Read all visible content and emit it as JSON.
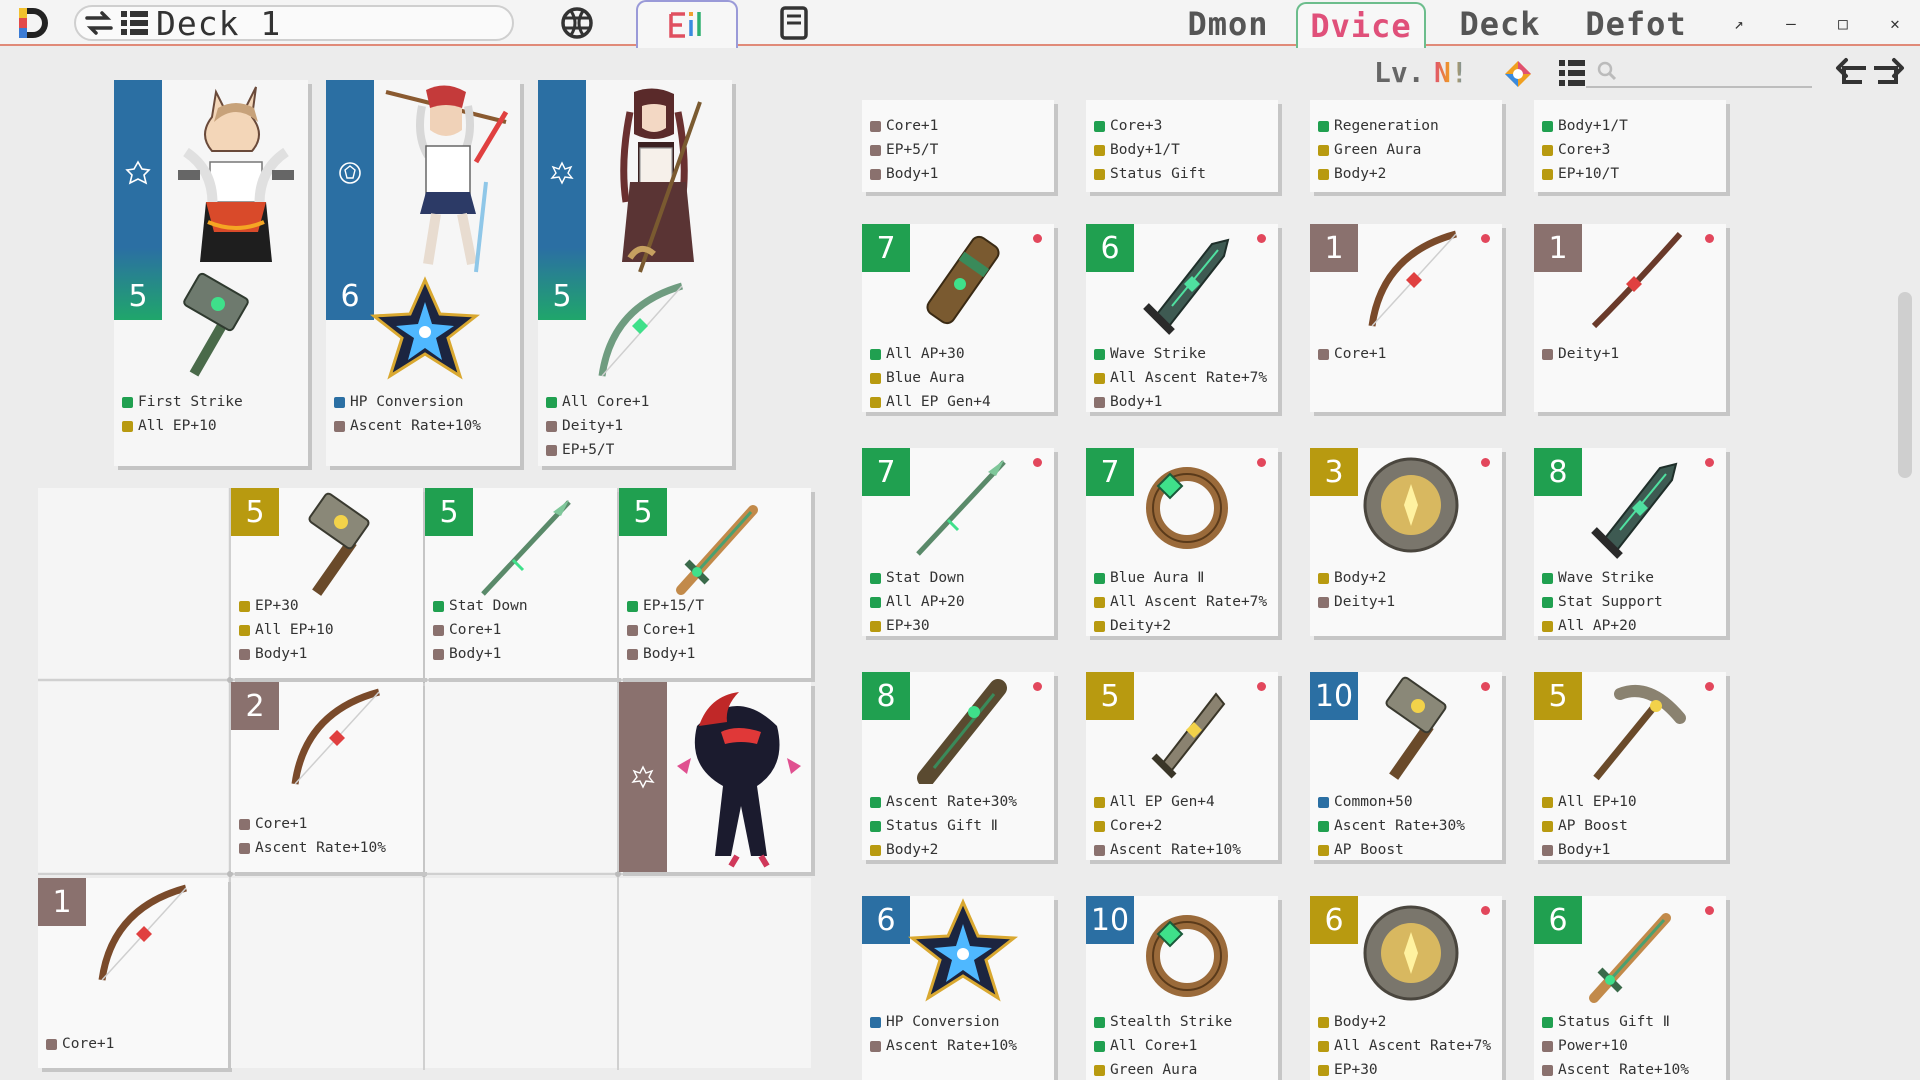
{
  "colors": {
    "green": "#20a050",
    "gold": "#b89a10",
    "brown": "#8a716e",
    "blue": "#2b6fa3",
    "dot_red": "#e2475c",
    "tab_pink": "#e0507a"
  },
  "header": {
    "deck_title": "Deck 1",
    "tabs": [
      {
        "label": "Dmon"
      },
      {
        "label": "Dvice"
      },
      {
        "label": "Deck"
      },
      {
        "label": "Defot"
      }
    ],
    "window_controls": {
      "restore": "↗",
      "minimize": "–",
      "maximize": "□",
      "close": "✕"
    }
  },
  "toolbar": {
    "lv_label": "Lv.",
    "n_label": "N!",
    "search_placeholder": ""
  },
  "characters": [
    {
      "level": "5",
      "effects": [
        {
          "text": "First Strike",
          "color": "green"
        },
        {
          "text": "All EP+10",
          "color": "gold"
        }
      ]
    },
    {
      "level": "6",
      "effects": [
        {
          "text": "HP Conversion",
          "color": "blue"
        },
        {
          "text": "Ascent Rate+10%",
          "color": "brown"
        }
      ]
    },
    {
      "level": "5",
      "effects": [
        {
          "text": "All Core+1",
          "color": "green"
        },
        {
          "text": "Deity+1",
          "color": "brown"
        },
        {
          "text": "EP+5/T",
          "color": "brown"
        }
      ]
    }
  ],
  "grid": {
    "cells": [
      {
        "id": "c1",
        "level": "5",
        "badge": "gold",
        "icon": "hammer-icon",
        "effects": [
          {
            "text": "EP+30",
            "color": "gold"
          },
          {
            "text": "All EP+10",
            "color": "gold"
          },
          {
            "text": "Body+1",
            "color": "brown"
          }
        ]
      },
      {
        "id": "c2",
        "level": "5",
        "badge": "green",
        "icon": "spear-icon",
        "effects": [
          {
            "text": "Stat Down",
            "color": "green"
          },
          {
            "text": "Core+1",
            "color": "brown"
          },
          {
            "text": "Body+1",
            "color": "brown"
          }
        ]
      },
      {
        "id": "c3",
        "level": "5",
        "badge": "green",
        "icon": "sword-icon",
        "effects": [
          {
            "text": "EP+15/T",
            "color": "green"
          },
          {
            "text": "Core+1",
            "color": "brown"
          },
          {
            "text": "Body+1",
            "color": "brown"
          }
        ]
      },
      {
        "id": "c4",
        "level": "2",
        "badge": "brown",
        "icon": "bow-icon",
        "effects": [
          {
            "text": "Core+1",
            "color": "brown"
          },
          {
            "text": "Ascent Rate+10%",
            "color": "brown"
          }
        ]
      },
      {
        "id": "c5",
        "level": "1",
        "badge": "brown",
        "icon": "bow-icon",
        "effects": [
          {
            "text": "Core+1",
            "color": "brown"
          }
        ]
      }
    ]
  },
  "inventory": {
    "top_partial": [
      [
        {
          "text": "Core+1",
          "color": "brown"
        },
        {
          "text": "EP+5/T",
          "color": "brown"
        },
        {
          "text": "Body+1",
          "color": "brown"
        }
      ],
      [
        {
          "text": "Core+3",
          "color": "green"
        },
        {
          "text": "Body+1/T",
          "color": "gold"
        },
        {
          "text": "Status Gift",
          "color": "gold"
        }
      ],
      [
        {
          "text": "Regeneration",
          "color": "green"
        },
        {
          "text": "Green Aura",
          "color": "gold"
        },
        {
          "text": "Body+2",
          "color": "gold"
        }
      ],
      [
        {
          "text": "Body+1/T",
          "color": "green"
        },
        {
          "text": "Core+3",
          "color": "gold"
        },
        {
          "text": "EP+10/T",
          "color": "gold"
        }
      ]
    ],
    "items": [
      {
        "level": "7",
        "badge": "green",
        "icon": "cannon-icon",
        "effects": [
          {
            "text": "All AP+30",
            "color": "green"
          },
          {
            "text": "Blue Aura",
            "color": "gold"
          },
          {
            "text": "All EP Gen+4",
            "color": "gold"
          }
        ]
      },
      {
        "level": "6",
        "badge": "green",
        "icon": "greatsword-icon",
        "effects": [
          {
            "text": "Wave Strike",
            "color": "green"
          },
          {
            "text": "All Ascent Rate+7%",
            "color": "gold"
          },
          {
            "text": "Body+1",
            "color": "brown"
          }
        ]
      },
      {
        "level": "1",
        "badge": "brown",
        "icon": "bow-icon",
        "effects": [
          {
            "text": "Core+1",
            "color": "brown"
          }
        ]
      },
      {
        "level": "1",
        "badge": "brown",
        "icon": "staff-icon",
        "effects": [
          {
            "text": "Deity+1",
            "color": "brown"
          }
        ]
      },
      {
        "level": "7",
        "badge": "green",
        "icon": "spear-icon",
        "effects": [
          {
            "text": "Stat Down",
            "color": "green"
          },
          {
            "text": "All AP+20",
            "color": "green"
          },
          {
            "text": "EP+30",
            "color": "gold"
          }
        ]
      },
      {
        "level": "7",
        "badge": "green",
        "icon": "ring-icon",
        "effects": [
          {
            "text": "Blue Aura Ⅱ",
            "color": "green"
          },
          {
            "text": "All Ascent Rate+7%",
            "color": "gold"
          },
          {
            "text": "Deity+2",
            "color": "gold"
          }
        ]
      },
      {
        "level": "3",
        "badge": "gold",
        "icon": "medallion-icon",
        "effects": [
          {
            "text": "Body+2",
            "color": "gold"
          },
          {
            "text": "Deity+1",
            "color": "brown"
          }
        ]
      },
      {
        "level": "8",
        "badge": "green",
        "icon": "greatsword-icon",
        "effects": [
          {
            "text": "Wave Strike",
            "color": "green"
          },
          {
            "text": "Stat Support",
            "color": "green"
          },
          {
            "text": "All AP+20",
            "color": "gold"
          }
        ]
      },
      {
        "level": "8",
        "badge": "green",
        "icon": "club-icon",
        "effects": [
          {
            "text": "Ascent Rate+30%",
            "color": "green"
          },
          {
            "text": "Status Gift Ⅱ",
            "color": "green"
          },
          {
            "text": "Body+2",
            "color": "gold"
          }
        ]
      },
      {
        "level": "5",
        "badge": "gold",
        "icon": "dagger-icon",
        "effects": [
          {
            "text": "All EP Gen+4",
            "color": "gold"
          },
          {
            "text": "Core+2",
            "color": "gold"
          },
          {
            "text": "Ascent Rate+10%",
            "color": "brown"
          }
        ]
      },
      {
        "level": "10",
        "badge": "blue",
        "icon": "hammer-icon",
        "effects": [
          {
            "text": "Common+50",
            "color": "blue"
          },
          {
            "text": "Ascent Rate+30%",
            "color": "green"
          },
          {
            "text": "AP Boost",
            "color": "gold"
          }
        ]
      },
      {
        "level": "5",
        "badge": "gold",
        "icon": "pickaxe-icon",
        "effects": [
          {
            "text": "All EP+10",
            "color": "gold"
          },
          {
            "text": "AP Boost",
            "color": "gold"
          },
          {
            "text": "Body+1",
            "color": "brown"
          }
        ]
      },
      {
        "level": "6",
        "badge": "blue",
        "icon": "gem-icon",
        "effects": [
          {
            "text": "HP Conversion",
            "color": "blue"
          },
          {
            "text": "Ascent Rate+10%",
            "color": "brown"
          }
        ]
      },
      {
        "level": "10",
        "badge": "blue",
        "icon": "ring-icon",
        "effects": [
          {
            "text": "Stealth Strike",
            "color": "green"
          },
          {
            "text": "All Core+1",
            "color": "green"
          },
          {
            "text": "Green Aura",
            "color": "gold"
          }
        ]
      },
      {
        "level": "6",
        "badge": "gold",
        "icon": "medallion-icon",
        "effects": [
          {
            "text": "Body+2",
            "color": "gold"
          },
          {
            "text": "All Ascent Rate+7%",
            "color": "gold"
          },
          {
            "text": "EP+30",
            "color": "gold"
          }
        ]
      },
      {
        "level": "6",
        "badge": "green",
        "icon": "sword-icon",
        "effects": [
          {
            "text": "Status Gift Ⅱ",
            "color": "green"
          },
          {
            "text": "Power+10",
            "color": "brown"
          },
          {
            "text": "Ascent Rate+10%",
            "color": "brown"
          }
        ]
      }
    ]
  }
}
